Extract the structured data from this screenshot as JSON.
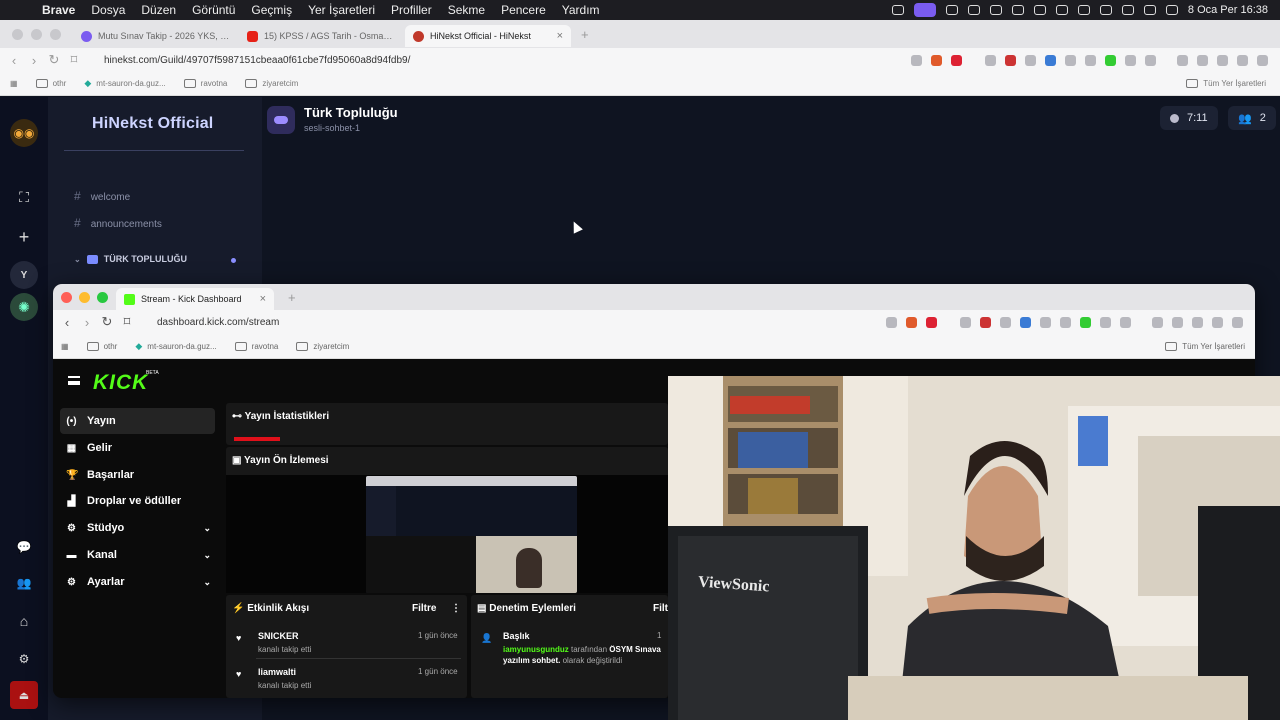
{
  "menubar": {
    "items": [
      "Brave",
      "Dosya",
      "Düzen",
      "Görüntü",
      "Geçmiş",
      "Yer İşaretleri",
      "Profiller",
      "Sekme",
      "Pencere",
      "Yardım"
    ],
    "clock": "8 Oca Per  16:38"
  },
  "outer_browser": {
    "tabs": [
      {
        "title": "Mutu Sınav Takip - 2026 YKS, KPSS",
        "color": "#7b5cf0"
      },
      {
        "title": "15) KPSS / AGS Tarih - Osmanlı De",
        "color": "#e62117"
      },
      {
        "title": "HiNekst Official - HiNekst",
        "color": "#c0392b"
      }
    ],
    "url": "hinekst.com/Guild/49707f5987151cbeaa0f61cbe7fd95060a8d94fdb9/",
    "bookmarks": [
      "othr",
      "mt-sauron-da.guz...",
      "ravotna",
      "ziyaretcim"
    ],
    "bookmarks_right": "Tüm Yer İşaretleri"
  },
  "hinekst": {
    "server_name": "HiNekst Official",
    "channels": [
      "welcome",
      "announcements"
    ],
    "category": "TÜRK TOPLULUĞU",
    "room_title": "Türk Topluluğu",
    "room_sub": "sesli-sohbet-1",
    "timer": "7:11",
    "members": "2",
    "rail_letter": "Y"
  },
  "inner_browser": {
    "tab": "Stream - Kick Dashboard",
    "url": "dashboard.kick.com/stream",
    "bookmarks": [
      "othr",
      "mt-sauron-da.guz...",
      "ravotna",
      "ziyaretcim"
    ],
    "bookmarks_right": "Tüm Yer İşaretleri"
  },
  "kick": {
    "logo": "KICK",
    "beta": "BETA",
    "nav": [
      {
        "label": "Yayın",
        "icon": "(•)",
        "selected": true
      },
      {
        "label": "Gelir",
        "icon": "▦"
      },
      {
        "label": "Başarılar",
        "icon": "🏆"
      },
      {
        "label": "Droplar ve ödüller",
        "icon": "▟"
      },
      {
        "label": "Stüdyo",
        "icon": "⚙",
        "chev": "⌄"
      },
      {
        "label": "Kanal",
        "icon": "▬",
        "chev": "⌄"
      },
      {
        "label": "Ayarlar",
        "icon": "⚙",
        "chev": "⌄"
      }
    ],
    "stats_title": "Yayın İstatistikleri",
    "preview_title": "Yayın Ön İzlemesi",
    "feed_title": "Etkinlik Akışı",
    "feed_filter": "Filtre",
    "feed": [
      {
        "name": "SNICKER",
        "desc": "kanalı takip etti",
        "time": "1 gün önce"
      },
      {
        "name": "liamwalti",
        "desc": "kanalı takip etti",
        "time": "1 gün önce"
      }
    ],
    "mod_title": "Denetim Eylemleri",
    "mod_filter": "Filt",
    "mod_entry": {
      "label": "Başlık",
      "user": "iamyunusgunduz",
      "text1": " tarafından ",
      "text2": "ÖSYM Sınava",
      "text3": "yazılım sohbet.",
      "text4": " olarak değiştirildi",
      "count": "1"
    }
  },
  "webcam": {
    "brand": "ViewSonic"
  },
  "colors": {
    "kick_green": "#53fc18",
    "accent_purple": "#7b8cff"
  }
}
